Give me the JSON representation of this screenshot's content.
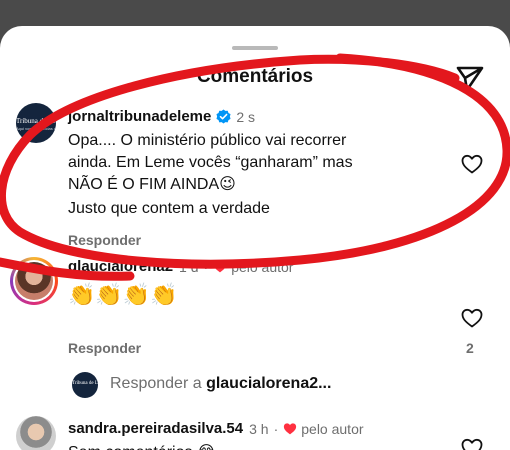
{
  "sheet": {
    "title": "Comentários",
    "share_icon": "paper-plane-icon"
  },
  "comments": [
    {
      "username": "jornaltribunadeleme",
      "verified": true,
      "time": "2 s",
      "avatar_text": "Tribuna de Leme",
      "avatar_subtext": "Aqui você lê notícias de Leme",
      "text_lines": [
        "Opa.... O ministério público vai recorrer",
        "ainda. Em Leme vocês “ganharam” mas",
        "NÃO É O FIM AINDA😉"
      ],
      "text_extra": "Justo que contem a verdade",
      "reply_label": "Responder"
    },
    {
      "username": "glaucialorena2",
      "time": "1 d",
      "separator": "·",
      "liked_by_author": "pelo autor",
      "text": "👏👏👏👏",
      "reply_label": "Responder",
      "likes": "2",
      "reply_prompt_prefix": "Responder a ",
      "reply_prompt_user": "glaucialorena2..."
    },
    {
      "username": "sandra.pereiradasilva.54",
      "time": "3 h",
      "separator": "·",
      "liked_by_author": "pelo autor",
      "text": "Sem comentários 😂"
    }
  ],
  "colors": {
    "annotation_red": "#e3171d",
    "heart_red": "#ff3040",
    "verified_blue": "#0095f6",
    "muted_text": "#6e6e6e"
  }
}
